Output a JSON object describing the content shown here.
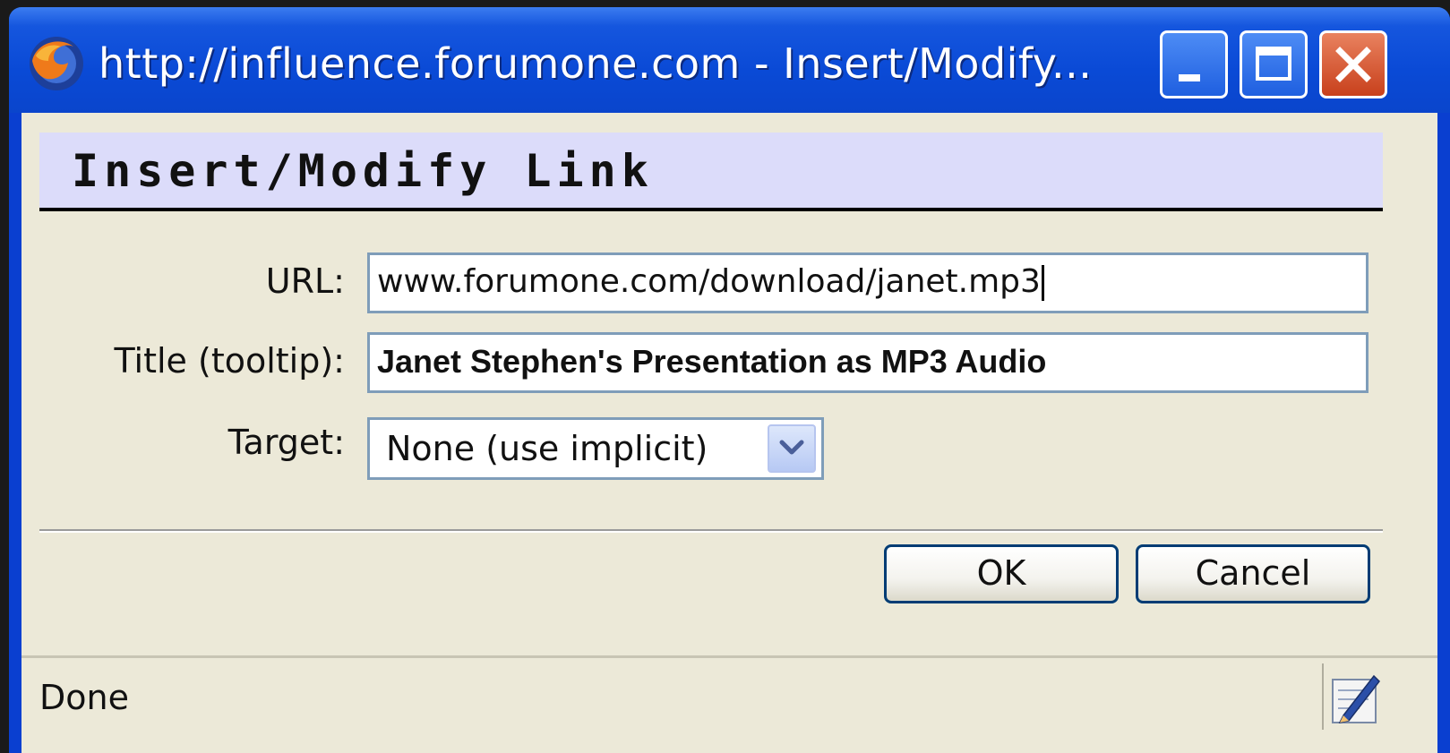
{
  "window": {
    "title": "http://influence.forumone.com - Insert/Modify...",
    "app_icon": "firefox-icon",
    "controls": [
      "minimize-icon",
      "maximize-icon",
      "close-icon"
    ]
  },
  "dialog": {
    "heading": "Insert/Modify Link",
    "fields": {
      "url": {
        "label": "URL:",
        "value": "www.forumone.com/download/janet.mp3"
      },
      "title": {
        "label": "Title (tooltip):",
        "value": "Janet Stephen's Presentation as MP3 Audio"
      },
      "target": {
        "label": "Target:",
        "selected": "None (use implicit)",
        "icon": "chevron-down-icon"
      }
    },
    "buttons": {
      "ok": "OK",
      "cancel": "Cancel"
    }
  },
  "statusbar": {
    "text": "Done",
    "icon": "edit-page-icon"
  },
  "colors": {
    "titlebar": "#0a4ad6",
    "header_band": "#dcdcfa",
    "dialog_bg": "#ece9d8",
    "input_border": "#7f9db9",
    "close_button": "#c8401c"
  }
}
